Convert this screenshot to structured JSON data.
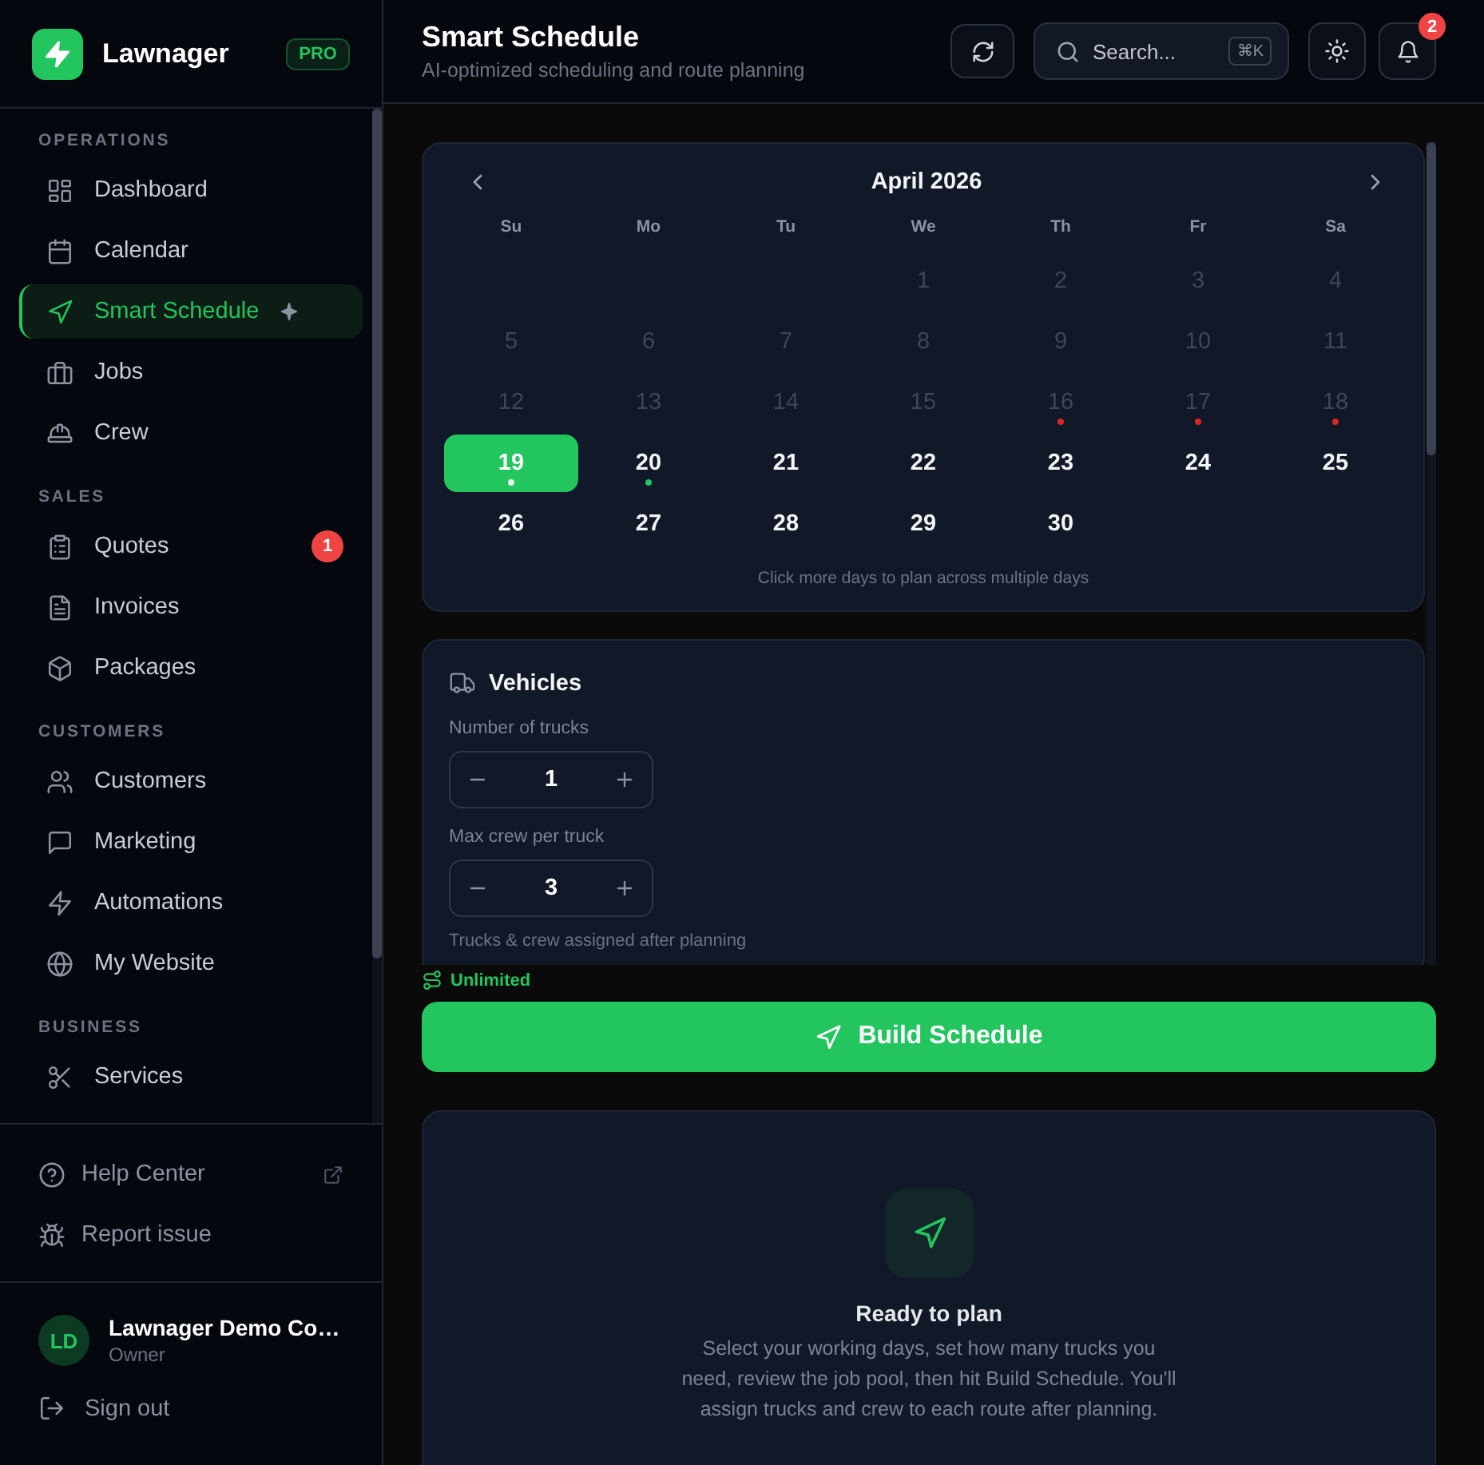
{
  "sidebar": {
    "brand": "Lawnager",
    "plan_badge": "PRO",
    "sections": [
      {
        "title": "OPERATIONS",
        "items": [
          {
            "label": "Dashboard",
            "selected": false,
            "sparkle": false
          },
          {
            "label": "Calendar",
            "selected": false,
            "sparkle": false
          },
          {
            "label": "Smart Schedule",
            "selected": true,
            "sparkle": true
          },
          {
            "label": "Jobs",
            "selected": false,
            "sparkle": false
          },
          {
            "label": "Crew",
            "selected": false,
            "sparkle": false
          }
        ]
      },
      {
        "title": "SALES",
        "items": [
          {
            "label": "Quotes",
            "selected": false,
            "sparkle": false,
            "badge": "1"
          },
          {
            "label": "Invoices",
            "selected": false,
            "sparkle": false
          },
          {
            "label": "Packages",
            "selected": false,
            "sparkle": false
          }
        ]
      },
      {
        "title": "CUSTOMERS",
        "items": [
          {
            "label": "Customers",
            "selected": false,
            "sparkle": false
          },
          {
            "label": "Marketing",
            "selected": false,
            "sparkle": false
          },
          {
            "label": "Automations",
            "selected": false,
            "sparkle": false
          },
          {
            "label": "My Website",
            "selected": false,
            "sparkle": false
          }
        ]
      },
      {
        "title": "BUSINESS",
        "items": [
          {
            "label": "Services",
            "selected": false,
            "sparkle": false
          }
        ]
      }
    ],
    "footer_links": [
      {
        "label": "Help Center",
        "external": true
      },
      {
        "label": "Report issue",
        "external": false
      }
    ],
    "profile": {
      "initials": "LD",
      "name": "Lawnager Demo Co…",
      "role": "Owner"
    },
    "sign_out": "Sign out"
  },
  "header": {
    "title": "Smart Schedule",
    "subtitle": "AI-optimized scheduling and route planning",
    "search": {
      "placeholder": "Search...",
      "shortcut": "⌘K"
    },
    "notifications": "2"
  },
  "calendar": {
    "month": "April 2026",
    "weekdays": [
      "Su",
      "Mo",
      "Tu",
      "We",
      "Th",
      "Fr",
      "Sa"
    ],
    "weeks": [
      [
        {
          "kind": "blank"
        },
        {
          "kind": "blank"
        },
        {
          "kind": "blank"
        },
        {
          "day": "1",
          "disabled": true,
          "selected": false
        },
        {
          "day": "2",
          "disabled": true,
          "selected": false
        },
        {
          "day": "3",
          "disabled": true,
          "selected": false
        },
        {
          "day": "4",
          "disabled": true,
          "selected": false
        }
      ],
      [
        {
          "day": "5",
          "disabled": true,
          "selected": false
        },
        {
          "day": "6",
          "disabled": true,
          "selected": false
        },
        {
          "day": "7",
          "disabled": true,
          "selected": false
        },
        {
          "day": "8",
          "disabled": true,
          "selected": false
        },
        {
          "day": "9",
          "disabled": true,
          "selected": false
        },
        {
          "day": "10",
          "disabled": true,
          "selected": false
        },
        {
          "day": "11",
          "disabled": true,
          "selected": false
        }
      ],
      [
        {
          "day": "12",
          "disabled": true,
          "selected": false
        },
        {
          "day": "13",
          "disabled": true,
          "selected": false
        },
        {
          "day": "14",
          "disabled": true,
          "selected": false
        },
        {
          "day": "15",
          "disabled": true,
          "selected": false
        },
        {
          "day": "16",
          "disabled": true,
          "selected": false,
          "color": "#dc2626"
        },
        {
          "day": "17",
          "disabled": true,
          "selected": false,
          "color": "#dc2626"
        },
        {
          "day": "18",
          "disabled": true,
          "selected": false,
          "color": "#dc2626"
        }
      ],
      [
        {
          "day": "19",
          "disabled": false,
          "selected": true,
          "color": "#e8faf0"
        },
        {
          "day": "20",
          "disabled": false,
          "selected": false,
          "color": "#22c55e"
        },
        {
          "day": "21",
          "disabled": false,
          "selected": false
        },
        {
          "day": "22",
          "disabled": false,
          "selected": false
        },
        {
          "day": "23",
          "disabled": false,
          "selected": false
        },
        {
          "day": "24",
          "disabled": false,
          "selected": false
        },
        {
          "day": "25",
          "disabled": false,
          "selected": false
        }
      ],
      [
        {
          "day": "26",
          "disabled": false,
          "selected": false
        },
        {
          "day": "27",
          "disabled": false,
          "selected": false
        },
        {
          "day": "28",
          "disabled": false,
          "selected": false
        },
        {
          "day": "29",
          "disabled": false,
          "selected": false
        },
        {
          "day": "30",
          "disabled": false,
          "selected": false
        }
      ]
    ],
    "hint": "Click more days to plan across multiple days"
  },
  "vehicles": {
    "title": "Vehicles",
    "steppers": [
      {
        "label": "Number of trucks",
        "value": "1"
      },
      {
        "label": "Max crew per truck",
        "value": "3"
      }
    ],
    "note": "Trucks & crew assigned after planning"
  },
  "plan_limit": "Unlimited",
  "build_button": "Build Schedule",
  "empty_state": {
    "title": "Ready to plan",
    "description": "Select your working days, set how many trucks you need, review the job pool, then hit Build Schedule. You'll assign trucks and crew to each route after planning."
  }
}
